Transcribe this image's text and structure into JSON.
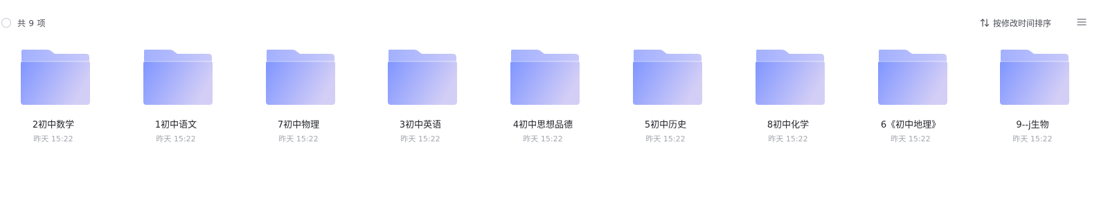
{
  "header": {
    "count_label": "共 9 项",
    "sort_label": "按修改时间排序"
  },
  "colors": {
    "folder_gradient_start": "#7f95ff",
    "folder_gradient_end": "#d3cef6",
    "folder_back": "#a7b3ff",
    "text_primary": "#25262b",
    "text_secondary": "#a4a7ae"
  },
  "icons": {
    "select_all": "circle-radio-icon",
    "sort": "sort-arrows-icon",
    "view": "list-view-icon",
    "folder": "folder-icon"
  },
  "folders": [
    {
      "name": "2初中数学",
      "time": "昨天 15:22"
    },
    {
      "name": "1初中语文",
      "time": "昨天 15:22"
    },
    {
      "name": "7初中物理",
      "time": "昨天 15:22"
    },
    {
      "name": "3初中英语",
      "time": "昨天 15:22"
    },
    {
      "name": "4初中思想品德",
      "time": "昨天 15:22"
    },
    {
      "name": "5初中历史",
      "time": "昨天 15:22"
    },
    {
      "name": "8初中化学",
      "time": "昨天 15:22"
    },
    {
      "name": "6《初中地理》",
      "time": "昨天 15:22"
    },
    {
      "name": "9--j生物",
      "time": "昨天 15:22"
    }
  ]
}
